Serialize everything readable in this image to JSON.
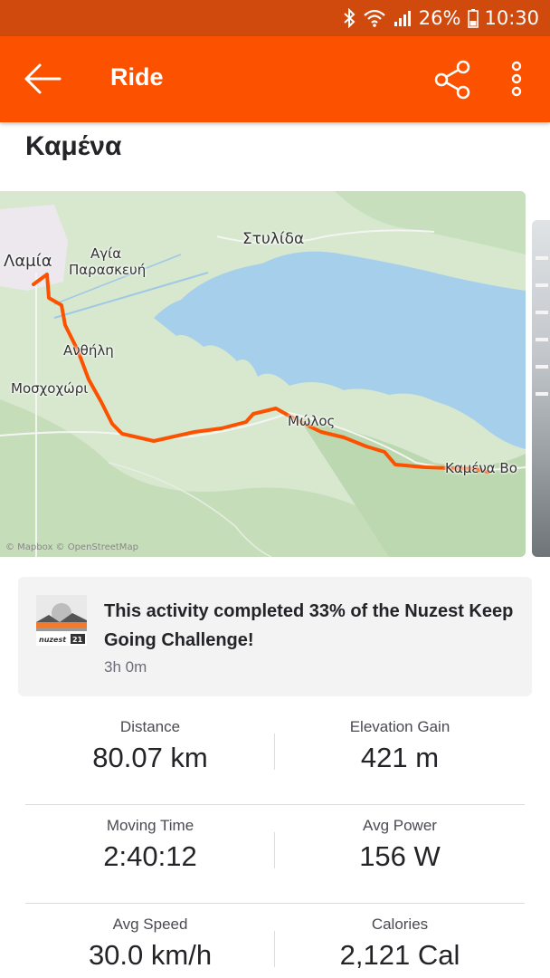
{
  "status_bar": {
    "battery": "26%",
    "time": "10:30",
    "icons": [
      "bluetooth-icon",
      "wifi-icon",
      "signal-icon",
      "battery-icon"
    ]
  },
  "app_bar": {
    "title": "Ride",
    "background": "#fc5200",
    "icons": [
      "back-arrow-icon",
      "share-icon",
      "more-vert-icon"
    ]
  },
  "activity": {
    "name": "Καμένα"
  },
  "map": {
    "labels": {
      "lamia": "Λαμία",
      "agia_paraskevi_1": "Αγία",
      "agia_paraskevi_2": "Παρασκευή",
      "stylida": "Στυλίδα",
      "anthili": "Ανθήλη",
      "moschochori": "Μοσχοχώρι",
      "molos": "Μώλος",
      "kamena_vourla": "Καμένα Βο"
    },
    "attribution": "© Mapbox © OpenStreetMap",
    "route_color": "#fc5200",
    "water_color": "#a6cfeb"
  },
  "challenge": {
    "badge_text": "nuzest",
    "badge_number": "21",
    "text": "This activity completed 33% of the Nuzest Keep Going Challenge!",
    "duration": "3h 0m"
  },
  "stats": [
    {
      "label": "Distance",
      "value": "80.07 km"
    },
    {
      "label": "Elevation Gain",
      "value": "421 m"
    },
    {
      "label": "Moving Time",
      "value": "2:40:12"
    },
    {
      "label": "Avg Power",
      "value": "156 W"
    },
    {
      "label": "Avg Speed",
      "value": "30.0 km/h"
    },
    {
      "label": "Calories",
      "value": "2,121 Cal"
    }
  ]
}
